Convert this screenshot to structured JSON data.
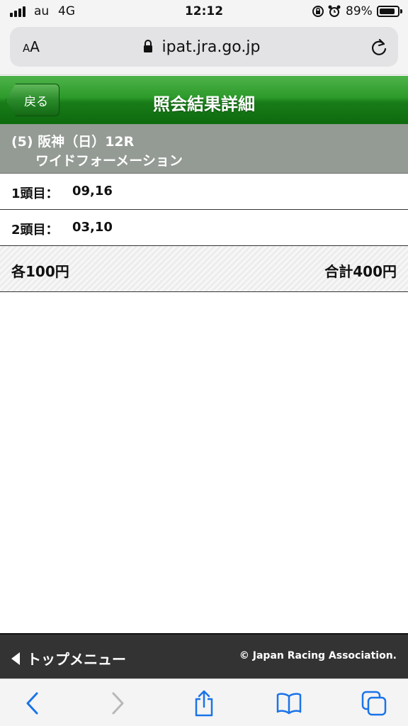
{
  "status_bar": {
    "carrier": "au",
    "network": "4G",
    "time": "12:12",
    "battery_percent": "89%",
    "icons": [
      "signal-icon",
      "rotation-lock-icon",
      "alarm-icon",
      "battery-icon"
    ]
  },
  "browser": {
    "text_size_label_small": "A",
    "text_size_label_large": "A",
    "url": "ipat.jra.go.jp",
    "icons": [
      "padlock-icon",
      "reload-icon",
      "back-icon",
      "forward-icon",
      "share-icon",
      "bookmarks-icon",
      "tabs-icon"
    ]
  },
  "header": {
    "back_label": "戻る",
    "title": "照会結果詳細",
    "color": "#1a7f1a"
  },
  "race": {
    "line1": "(5) 阪神（日）12R",
    "line2": "ワイドフォーメーション"
  },
  "selections": [
    {
      "label": "1頭目：",
      "value": "09,16"
    },
    {
      "label": "2頭目：",
      "value": "03,10"
    }
  ],
  "summary": {
    "each": "各100円",
    "total": "合計400円"
  },
  "footer": {
    "top_menu_label": "トップメニュー",
    "copyright": "© Japan Racing Association."
  }
}
